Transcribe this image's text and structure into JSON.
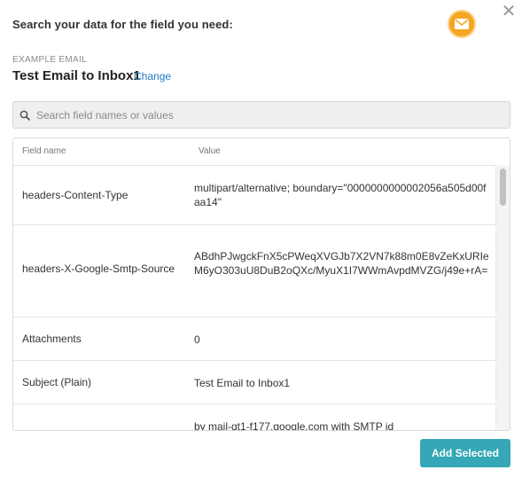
{
  "header": {
    "prompt": "Search your data for the field you need:",
    "close_glyph": "✕",
    "app_icon": "mail-envelope-icon",
    "accent_color": "#f6a623"
  },
  "example": {
    "label": "EXAMPLE EMAIL",
    "title": "Test Email to Inbox1",
    "change_label": "Change"
  },
  "search": {
    "placeholder": "Search field names or values",
    "value": ""
  },
  "table": {
    "columns": {
      "name": "Field name",
      "value": "Value"
    },
    "rows": [
      {
        "name": "headers-Content-Type",
        "value": " multipart/alternative; boundary=\"0000000000002056a505d00faa14\""
      },
      {
        "name": "headers-X-Google-Smtp-Source",
        "value": "ABdhPJwgckFnX5cPWeqXVGJb7X2VN7k88m0E8vZeKxURIeM6yO303uU8DuB2oQXc/MyuX1I7WWmAvpdMVZG/j49e+rA="
      },
      {
        "name": "Attachments",
        "value": "0"
      },
      {
        "name": "Subject (Plain)",
        "value": "Test Email to Inbox1"
      },
      {
        "name": "",
        "value": " by mail-qt1-f177.google.com with SMTP id"
      }
    ]
  },
  "footer": {
    "add_label": "Add Selected",
    "button_color": "#35a7b6"
  }
}
